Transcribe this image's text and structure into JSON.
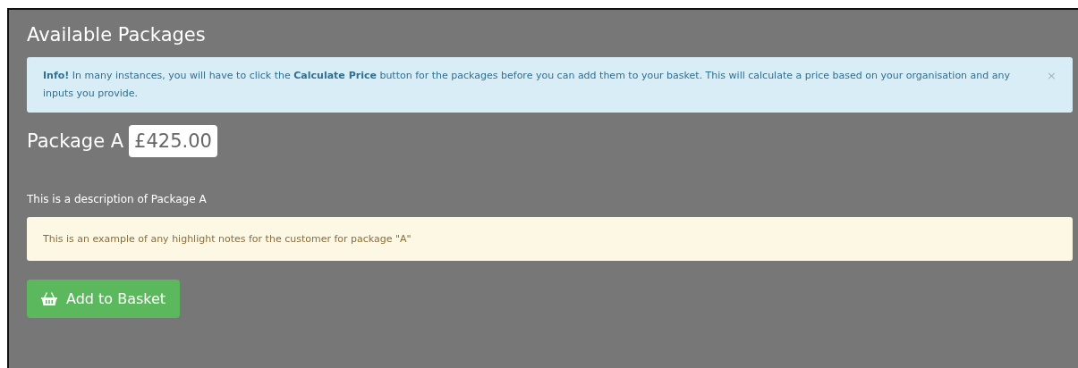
{
  "heading": "Available Packages",
  "info_alert": {
    "text": "**Info!** In many instances, you will have to click the **Calculate Price** button for the packages before you can add them to your basket. This will calculate a price based on your organisation and any inputs you provide.",
    "close": "×"
  },
  "packages": [
    {
      "name": "Package A",
      "price": "£425.00",
      "description": "This is a description of Package A",
      "note": "This is an example of any highlight notes for the customer for package \"A\"",
      "button": "Add to Basket"
    }
  ]
}
